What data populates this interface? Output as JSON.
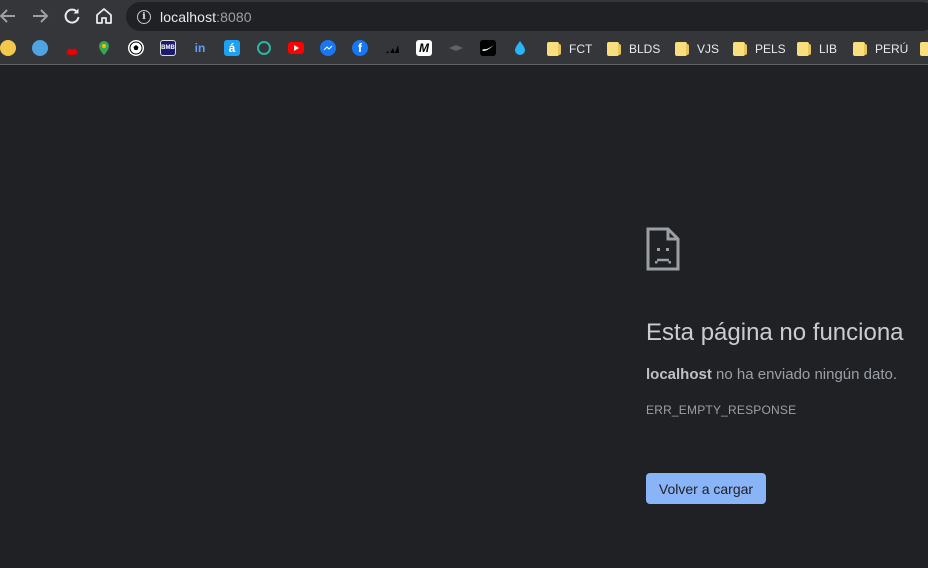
{
  "toolbar": {
    "back_icon": "arrow-left-icon",
    "forward_icon": "arrow-right-icon",
    "reload_icon": "reload-icon",
    "home_icon": "home-icon",
    "info_icon": "info-icon",
    "url_host": "localhost",
    "url_port": ":8080"
  },
  "bookmarks": {
    "icons": [
      {
        "name": "pokeball-icon",
        "color": "#f2c94c"
      },
      {
        "name": "mexico-flag-icon",
        "color": "#4fa3e0"
      },
      {
        "name": "santander-icon",
        "color": "#ec0000"
      },
      {
        "name": "google-maps-icon",
        "color": "#34a853"
      },
      {
        "name": "soccer-ball-icon",
        "color": "#ffffff"
      },
      {
        "name": "bmb-icon",
        "color": "#1a1a6e"
      },
      {
        "name": "linkedin-icon",
        "color": "#0a66c2"
      },
      {
        "name": "bold-a-icon",
        "color": "#1da1f2"
      },
      {
        "name": "circle-logo-icon",
        "color": "#2bb3a3"
      },
      {
        "name": "youtube-icon",
        "color": "#ff0000"
      },
      {
        "name": "messenger-icon",
        "color": "#1877f2"
      },
      {
        "name": "facebook-icon",
        "color": "#1877f2"
      },
      {
        "name": "adidas-icon",
        "color": "#000000"
      },
      {
        "name": "m-logo-icon",
        "color": "#000000"
      },
      {
        "name": "gray-logo-icon",
        "color": "#6b6b6b"
      },
      {
        "name": "nike-icon",
        "color": "#000000"
      },
      {
        "name": "drop-icon",
        "color": "#29b6f6"
      }
    ],
    "folders": [
      "FCT",
      "BLDS",
      "VJS",
      "PELS",
      "LIB",
      "PERÚ"
    ]
  },
  "error": {
    "icon": "sad-document-icon",
    "title": "Esta página no funciona",
    "host": "localhost",
    "message": " no ha enviado ningún dato.",
    "code": "ERR_EMPTY_RESPONSE",
    "reload_label": "Volver a cargar",
    "button_color": "#8ab4f8"
  }
}
